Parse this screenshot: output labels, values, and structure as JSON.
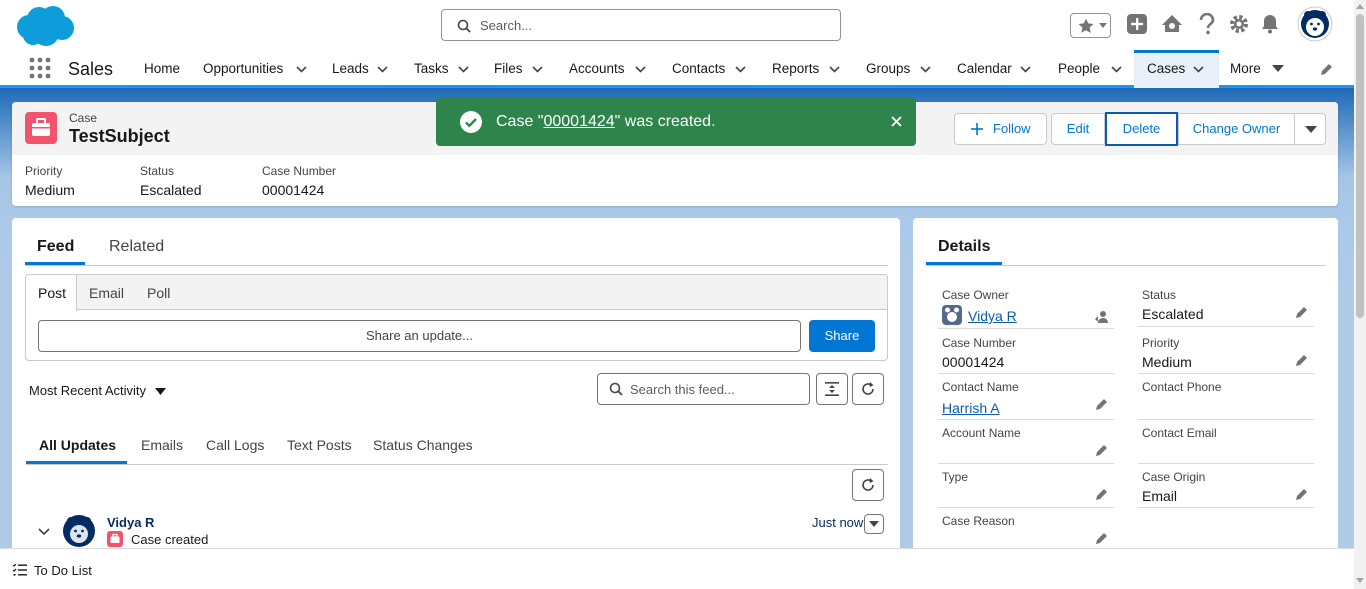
{
  "search": {
    "placeholder": "Search..."
  },
  "app": {
    "name": "Sales"
  },
  "nav": {
    "items": [
      {
        "label": "Home"
      },
      {
        "label": "Opportunities"
      },
      {
        "label": "Leads"
      },
      {
        "label": "Tasks"
      },
      {
        "label": "Files"
      },
      {
        "label": "Accounts"
      },
      {
        "label": "Contacts"
      },
      {
        "label": "Reports"
      },
      {
        "label": "Groups"
      },
      {
        "label": "Calendar"
      },
      {
        "label": "People"
      },
      {
        "label": "Cases",
        "active": true
      },
      {
        "label": "More"
      }
    ]
  },
  "record": {
    "object_label": "Case",
    "title": "TestSubject",
    "highlights": [
      {
        "label": "Priority",
        "value": "Medium"
      },
      {
        "label": "Status",
        "value": "Escalated"
      },
      {
        "label": "Case Number",
        "value": "00001424"
      }
    ],
    "actions": {
      "follow": "Follow",
      "edit": "Edit",
      "delete": "Delete",
      "change_owner": "Change Owner"
    }
  },
  "toast": {
    "prefix": "Case \"",
    "link": "00001424",
    "suffix": "\" was created."
  },
  "feed": {
    "tabs": [
      "Feed",
      "Related"
    ],
    "publisher_tabs": [
      "Post",
      "Email",
      "Poll"
    ],
    "share_placeholder": "Share an update...",
    "share_button": "Share",
    "sort_label": "Most Recent Activity",
    "search_placeholder": "Search this feed...",
    "filters": [
      "All Updates",
      "Emails",
      "Call Logs",
      "Text Posts",
      "Status Changes"
    ],
    "item": {
      "author": "Vidya R",
      "action": "Case created",
      "time": "Just now"
    }
  },
  "details": {
    "tab": "Details",
    "fields": {
      "case_owner": {
        "label": "Case Owner",
        "value": "Vidya R"
      },
      "status": {
        "label": "Status",
        "value": "Escalated"
      },
      "case_number": {
        "label": "Case Number",
        "value": "00001424"
      },
      "priority": {
        "label": "Priority",
        "value": "Medium"
      },
      "contact_name": {
        "label": "Contact Name",
        "value": "Harrish A"
      },
      "contact_phone": {
        "label": "Contact Phone",
        "value": ""
      },
      "account_name": {
        "label": "Account Name",
        "value": ""
      },
      "contact_email": {
        "label": "Contact Email",
        "value": ""
      },
      "type": {
        "label": "Type",
        "value": ""
      },
      "case_origin": {
        "label": "Case Origin",
        "value": "Email"
      },
      "case_reason": {
        "label": "Case Reason",
        "value": ""
      }
    }
  },
  "utility": {
    "todo": "To Do List"
  },
  "colors": {
    "brand": "#0176d3",
    "success": "#2e844a",
    "case_icon": "#f2536d"
  }
}
